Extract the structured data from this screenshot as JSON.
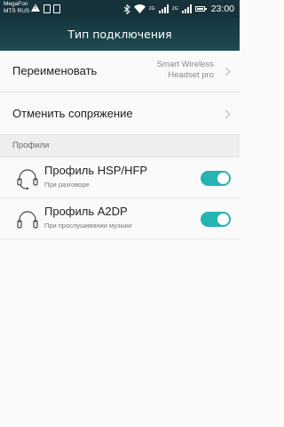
{
  "status_bar": {
    "carrier1": "MegaFon",
    "carrier2": "MTS RUS",
    "net1": "2G",
    "net2": "2G",
    "time": "23:00"
  },
  "header": {
    "title": "Тип подключения"
  },
  "rename": {
    "label": "Переименовать",
    "value": "Smart Wireless Headset pro"
  },
  "unpair": {
    "label": "Отменить сопряжение"
  },
  "profiles": {
    "section_title": "Профили",
    "items": [
      {
        "title": "Профиль HSP/HFP",
        "subtitle": "При разговоре",
        "icon": "headset-mic-icon",
        "enabled": true
      },
      {
        "title": "Профиль A2DP",
        "subtitle": "При прослушивании музыки",
        "icon": "headphones-icon",
        "enabled": true
      }
    ]
  },
  "colors": {
    "header_bg": "#1f4b52",
    "toggle_on": "#25b4b2"
  }
}
